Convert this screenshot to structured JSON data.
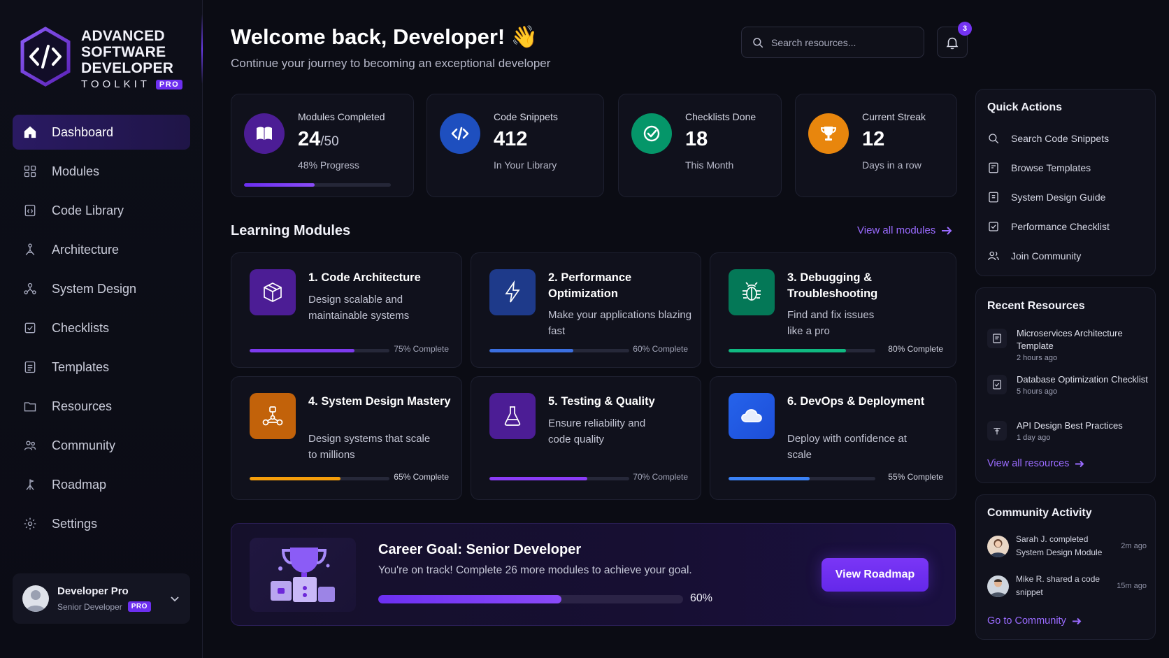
{
  "brand": {
    "line1": "Advanced",
    "line2": "Software",
    "line3": "Developer",
    "toolkit": "TOOLKIT",
    "badge": "PRO",
    "accent": "#6d2ff0"
  },
  "nav": {
    "items": [
      {
        "label": "Dashboard",
        "icon": "home-icon",
        "active": true
      },
      {
        "label": "Modules",
        "icon": "grid-icon"
      },
      {
        "label": "Code Library",
        "icon": "code-file-icon"
      },
      {
        "label": "Architecture",
        "icon": "architecture-icon"
      },
      {
        "label": "System Design",
        "icon": "system-design-icon"
      },
      {
        "label": "Checklists",
        "icon": "checklist-icon"
      },
      {
        "label": "Templates",
        "icon": "template-icon"
      },
      {
        "label": "Resources",
        "icon": "folder-icon"
      },
      {
        "label": "Community",
        "icon": "community-icon"
      },
      {
        "label": "Roadmap",
        "icon": "roadmap-icon"
      },
      {
        "label": "Settings",
        "icon": "gear-icon"
      }
    ]
  },
  "user": {
    "name": "Developer Pro",
    "role": "Senior Developer",
    "badge": "PRO"
  },
  "header": {
    "title": "Welcome back, Developer! 👋",
    "subtitle": "Continue your journey to becoming an exceptional developer",
    "search_placeholder": "Search resources...",
    "notification_count": "3"
  },
  "stats": [
    {
      "label": "Modules Completed",
      "value": "24",
      "total": "/50",
      "sub": "48% Progress",
      "progress": 48,
      "color": "#5b21b6",
      "icon": "book-icon"
    },
    {
      "label": "Code Snippets",
      "value": "412",
      "sub": "In Your Library",
      "color": "#1d4ed8",
      "icon": "code-icon"
    },
    {
      "label": "Checklists Done",
      "value": "18",
      "sub": "This Month",
      "color": "#059669",
      "icon": "check-circle-icon"
    },
    {
      "label": "Current Streak",
      "value": "12",
      "sub": "Days in a row",
      "color": "#ea8a0c",
      "icon": "trophy-icon"
    }
  ],
  "modules_section": {
    "title": "Learning Modules",
    "view_all": "View all modules"
  },
  "modules": [
    {
      "title": "1. Code Architecture",
      "desc": "Design scalable and maintainable systems",
      "progress": 75,
      "pct_label": "75% Complete",
      "color": "#5b21b6",
      "bar": "#7c3aed",
      "icon": "cube-icon"
    },
    {
      "title": "2. Performance Optimization",
      "desc": "Make your applications blazing fast",
      "progress": 60,
      "pct_label": "60% Complete",
      "color": "#1e40af",
      "bar": "#3b6fe0",
      "icon": "bolt-icon"
    },
    {
      "title": "3. Debugging & Troubleshooting",
      "desc": "Find and fix issues like a pro",
      "progress": 80,
      "pct_label": "80% Complete",
      "color": "#047857",
      "bar": "#10b981",
      "icon": "bug-icon"
    },
    {
      "title": "4. System Design Mastery",
      "desc": "Design systems that scale to millions",
      "progress": 65,
      "pct_label": "65% Complete",
      "color": "#c2620a",
      "bar": "#f59e0b",
      "icon": "network-icon"
    },
    {
      "title": "5. Testing & Quality",
      "desc": "Ensure reliability and code quality",
      "progress": 70,
      "pct_label": "70% Complete",
      "color": "#4c1d95",
      "bar": "#8b3cf7",
      "icon": "flask-icon"
    },
    {
      "title": "6. DevOps & Deployment",
      "desc": "Deploy with confidence at scale",
      "progress": 55,
      "pct_label": "55% Complete",
      "color": "#1d4ed8",
      "bar": "#3b82f6",
      "icon": "cloud-icon"
    }
  ],
  "career": {
    "title": "Career Goal: Senior Developer",
    "desc": "You're on track! Complete 26 more modules to achieve your goal.",
    "progress": 60,
    "pct_label": "60%",
    "button": "View Roadmap"
  },
  "quick_actions": {
    "title": "Quick Actions",
    "items": [
      {
        "label": "Search Code Snippets",
        "icon": "search-code-icon"
      },
      {
        "label": "Browse Templates",
        "icon": "template-icon"
      },
      {
        "label": "System Design Guide",
        "icon": "guide-icon"
      },
      {
        "label": "Performance Checklist",
        "icon": "checkbox-icon"
      },
      {
        "label": "Join Community",
        "icon": "users-icon"
      }
    ]
  },
  "recent_resources": {
    "title": "Recent Resources",
    "items": [
      {
        "title": "Microservices Architecture Template",
        "time": "2 hours ago",
        "icon": "document-icon"
      },
      {
        "title": "Database Optimization Checklist",
        "time": "5 hours ago",
        "icon": "checklist-doc-icon"
      },
      {
        "title": "API Design Best Practices",
        "time": "1 day ago",
        "icon": "api-icon"
      }
    ],
    "link": "View all resources"
  },
  "community": {
    "title": "Community Activity",
    "items": [
      {
        "text1": "Sarah J. completed",
        "text2": "System Design Module",
        "time": "2m ago"
      },
      {
        "text1": "Mike R. shared a code",
        "text2": "snippet",
        "time": "15m ago"
      }
    ],
    "link": "Go to Community"
  }
}
